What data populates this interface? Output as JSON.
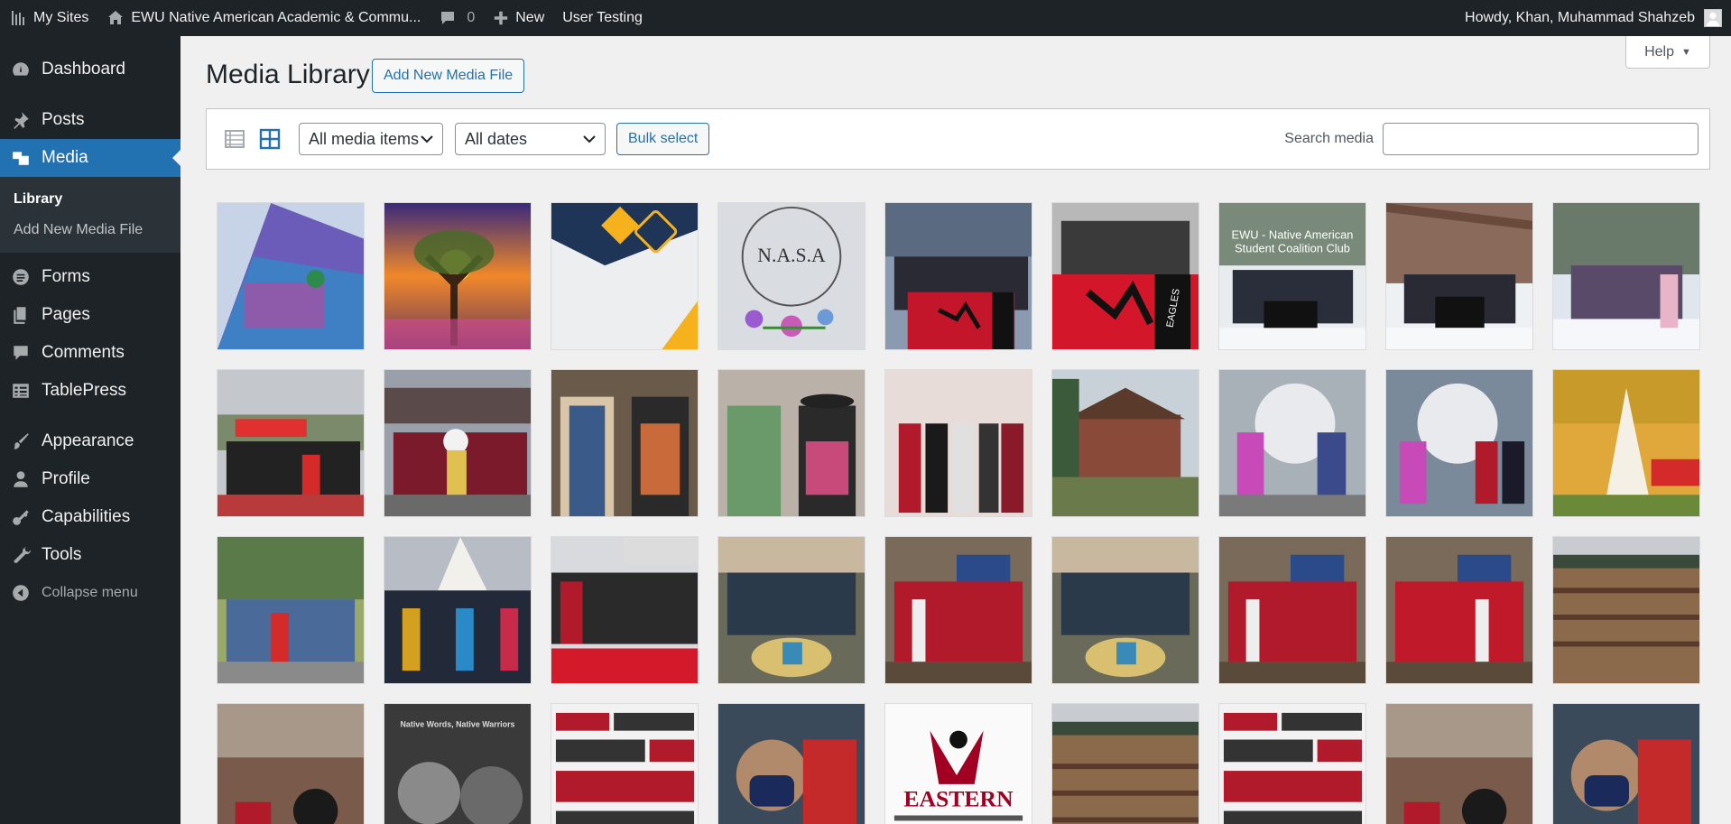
{
  "admin_bar": {
    "my_sites": "My Sites",
    "site_name": "EWU Native American Academic & Commu...",
    "comments_count": "0",
    "new_label": "New",
    "user_testing": "User Testing",
    "howdy": "Howdy, Khan, Muhammad Shahzeb"
  },
  "sidebar": {
    "dashboard": "Dashboard",
    "posts": "Posts",
    "media": "Media",
    "library": "Library",
    "add_new_media_file": "Add New Media File",
    "forms": "Forms",
    "pages": "Pages",
    "comments": "Comments",
    "tablepress": "TablePress",
    "appearance": "Appearance",
    "profile": "Profile",
    "capabilities": "Capabilities",
    "tools": "Tools",
    "collapse": "Collapse menu"
  },
  "header": {
    "title": "Media Library",
    "add_new": "Add New Media File",
    "help": "Help"
  },
  "toolbar": {
    "type_filter": "All media items",
    "date_filter": "All dates",
    "bulk_select": "Bulk select",
    "search_label": "Search media",
    "search_value": ""
  },
  "thumb_text": {
    "club_caption": "EWU - Native American Student Coalition Club",
    "nasa": "N.A.S.A",
    "eastern": "EASTERN",
    "eagles": "EAGLES",
    "museum": "Native Words, Native Warriors"
  },
  "colors": {
    "admin_bg": "#1d2327",
    "accent": "#2271b1",
    "page_bg": "#f0f0f1",
    "ewu_red": "#a10022"
  }
}
